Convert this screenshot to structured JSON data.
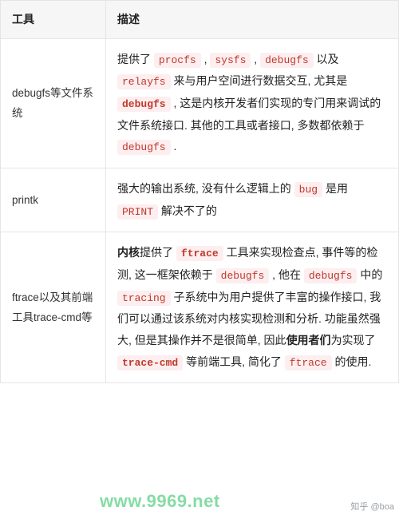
{
  "headers": {
    "tool": "工具",
    "desc": "描述"
  },
  "rows": [
    {
      "tool": "debugfs等文件系统",
      "desc": [
        {
          "t": "text",
          "v": "提供了 "
        },
        {
          "t": "code",
          "v": "procfs"
        },
        {
          "t": "text",
          "v": " , "
        },
        {
          "t": "code",
          "v": "sysfs"
        },
        {
          "t": "text",
          "v": " , "
        },
        {
          "t": "code",
          "v": "debugfs"
        },
        {
          "t": "text",
          "v": " 以及 "
        },
        {
          "t": "code",
          "v": "relayfs"
        },
        {
          "t": "text",
          "v": " 来与用户空间进行数据交互, 尤其是 "
        },
        {
          "t": "code",
          "b": true,
          "v": "debugfs"
        },
        {
          "t": "text",
          "v": " , 这是内核开发者们实现的专门用来调试的文件系统接口. 其他的工具或者接口, 多数都依赖于 "
        },
        {
          "t": "code",
          "v": "debugfs"
        },
        {
          "t": "text",
          "v": " ."
        }
      ]
    },
    {
      "tool": "printk",
      "desc": [
        {
          "t": "text",
          "v": "强大的输出系统, 没有什么逻辑上的 "
        },
        {
          "t": "code",
          "v": "bug"
        },
        {
          "t": "text",
          "v": " 是用 "
        },
        {
          "t": "code",
          "v": "PRINT"
        },
        {
          "t": "text",
          "v": " 解决不了的"
        }
      ]
    },
    {
      "tool": "ftrace以及其前端工具trace-cmd等",
      "desc": [
        {
          "t": "bold",
          "v": "内核"
        },
        {
          "t": "text",
          "v": "提供了 "
        },
        {
          "t": "code",
          "b": true,
          "v": "ftrace"
        },
        {
          "t": "text",
          "v": " 工具来实现检查点, 事件等的检测, 这一框架依赖于 "
        },
        {
          "t": "code",
          "v": "debugfs"
        },
        {
          "t": "text",
          "v": " , 他在 "
        },
        {
          "t": "code",
          "v": "debugfs"
        },
        {
          "t": "text",
          "v": " 中的 "
        },
        {
          "t": "code",
          "v": "tracing"
        },
        {
          "t": "text",
          "v": " 子系统中为用户提供了丰富的操作接口, 我们可以通过该系统对内核实现检测和分析. 功能虽然强大, 但是其操作并不是很简单, 因此"
        },
        {
          "t": "bold",
          "v": "使用者们"
        },
        {
          "t": "text",
          "v": "为实现了 "
        },
        {
          "t": "code",
          "b": true,
          "v": "trace-cmd"
        },
        {
          "t": "text",
          "v": " 等前端工具, 简化了 "
        },
        {
          "t": "code",
          "v": "ftrace"
        },
        {
          "t": "text",
          "v": " 的使用."
        }
      ]
    }
  ],
  "watermark": "www.9969.net",
  "attribution": "知乎 @boa"
}
